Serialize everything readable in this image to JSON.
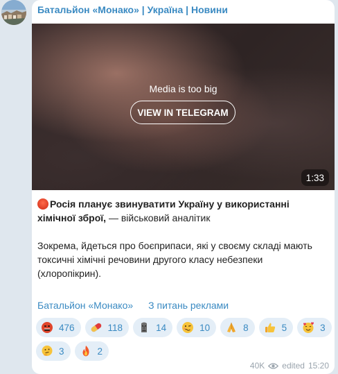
{
  "channel": {
    "name": "Батальйон «Монако» | Україна | Новини"
  },
  "media": {
    "notice": "Media is too big",
    "button_label": "VIEW IN TELEGRAM",
    "duration": "1:33"
  },
  "post": {
    "headline_bold": "Росія планує звинуватити Україну у використанні хімічної зброї,",
    "headline_rest": " — військовий аналітик",
    "paragraph": "Зокрема, йдеться про боєприпаси, які у своєму складі мають токсичні хімічні речовини другого класу небезпеки (хлоропікрин)."
  },
  "links": {
    "channel_link": "Батальйон «Монако»",
    "ads_link": "З питань реклами"
  },
  "reactions": [
    {
      "icon": "rage-face-icon",
      "count": "476"
    },
    {
      "icon": "pill-icon",
      "count": "118"
    },
    {
      "icon": "moai-icon",
      "count": "14"
    },
    {
      "icon": "woozy-face-icon",
      "count": "10"
    },
    {
      "icon": "folded-hands-icon",
      "count": "8"
    },
    {
      "icon": "thumbs-up-icon",
      "count": "5"
    },
    {
      "icon": "smiling-hearts-face-icon",
      "count": "3"
    },
    {
      "icon": "thinking-face-icon",
      "count": "3"
    },
    {
      "icon": "fire-icon",
      "count": "2"
    }
  ],
  "meta": {
    "views": "40K",
    "edited_label": "edited",
    "time": "15:20"
  },
  "colors": {
    "accent": "#3a8ac2",
    "background": "#dfe7ee",
    "reaction_bg": "#e4eef7"
  }
}
